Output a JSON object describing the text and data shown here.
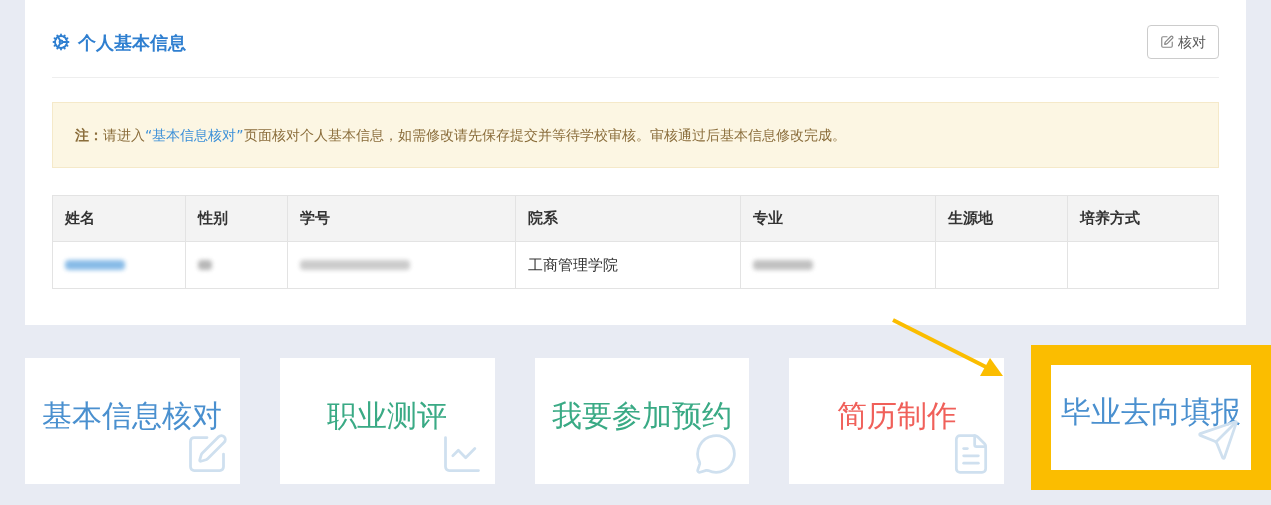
{
  "panel": {
    "title": "个人基本信息",
    "check_button": "核对"
  },
  "notice": {
    "label": "注：",
    "before": "请进入",
    "link": "“基本信息核对”",
    "after": "页面核对个人基本信息，如需修改请先保存提交并等待学校审核。审核通过后基本信息修改完成。"
  },
  "table": {
    "columns": [
      "姓名",
      "性别",
      "学号",
      "院系",
      "专业",
      "生源地",
      "培养方式"
    ],
    "rows": [
      [
        {
          "kind": "redacted"
        },
        {
          "kind": "redacted"
        },
        {
          "kind": "redacted"
        },
        {
          "kind": "text",
          "text": "工商管理学院"
        },
        {
          "kind": "redacted"
        },
        {
          "kind": "empty"
        },
        {
          "kind": "empty"
        }
      ]
    ]
  },
  "tiles": [
    {
      "label": "基本信息核对",
      "color": "#4a90cf",
      "highlighted": false
    },
    {
      "label": "职业测评",
      "color": "#3aaa85",
      "highlighted": false
    },
    {
      "label": "我要参加预约",
      "color": "#3aaa85",
      "highlighted": false
    },
    {
      "label": "简历制作",
      "color": "#f0605a",
      "highlighted": false
    },
    {
      "label": "毕业去向填报",
      "color": "#4a90cf",
      "highlighted": true
    }
  ]
}
